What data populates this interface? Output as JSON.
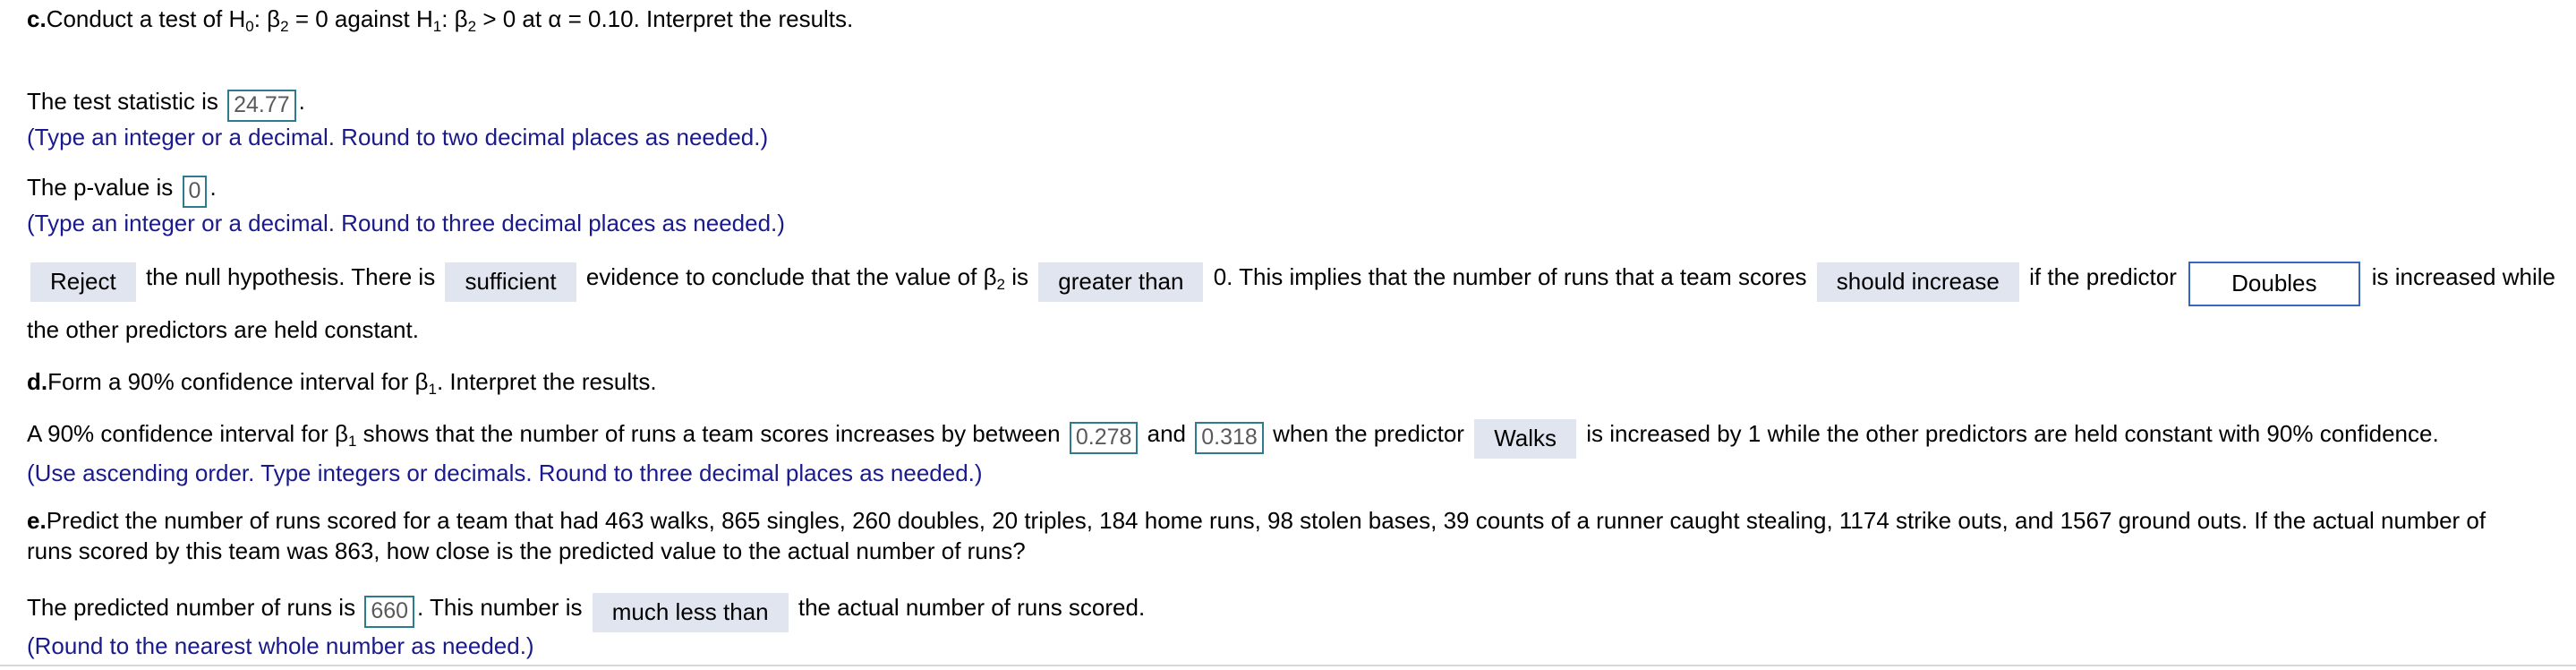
{
  "part_c": {
    "label": "c.",
    "prompt_a": "Conduct a test of H",
    "prompt_sub_0": "0",
    "prompt_b": ": β",
    "prompt_sub_2a": "2",
    "prompt_c": " = 0 against H",
    "prompt_sub_1": "1",
    "prompt_d": ": β",
    "prompt_sub_2b": "2",
    "prompt_e": " > 0 at α = 0.10. Interpret the results.",
    "test_statistic_label": "The test statistic is",
    "test_statistic_value": "24.77",
    "test_statistic_period": ".",
    "test_statistic_hint": "(Type an integer or a decimal. Round to two decimal places as needed.)",
    "pvalue_label": "The p-value is",
    "pvalue_value": "0",
    "pvalue_period": ".",
    "pvalue_hint": "(Type an integer or a decimal. Round to three decimal places as needed.)",
    "conclusion": {
      "dropdown_reject": "Reject",
      "text_1": "the null hypothesis. There is",
      "dropdown_sufficiency": "sufficient",
      "text_2": "evidence to conclude that the value of β",
      "text_2_sub": "2",
      "text_3": "is",
      "dropdown_direction": "greater than",
      "text_4": "0. This implies that the number of runs that a team scores",
      "dropdown_effect": "should increase",
      "text_5": "if the predictor",
      "dropdown_predictor": "Doubles",
      "text_6": "is increased while",
      "text_7": "the other predictors are held constant."
    }
  },
  "part_d": {
    "label": "d.",
    "prompt_a": "Form a 90% confidence interval for β",
    "prompt_sub_1": "1",
    "prompt_b": ". Interpret the results.",
    "answer": {
      "text_1": "A 90% confidence interval for β",
      "text_1_sub": "1",
      "text_2": "shows that the number of runs a team scores increases by between",
      "ci_lower": "0.278",
      "text_and": "and",
      "ci_upper": "0.318",
      "text_3": "when the predictor",
      "dropdown_predictor": "Walks",
      "text_4": "is increased by 1 while the other predictors are held constant with 90% confidence."
    },
    "hint": "(Use ascending order. Type integers or decimals. Round to three decimal places as needed.)"
  },
  "part_e": {
    "label": "e.",
    "prompt_line1": "Predict the number of runs scored for a team that had 463 walks, 865 singles, 260 doubles, 20 triples, 184 home runs, 98 stolen bases, 39 counts of a runner caught stealing, 1174 strike outs, and 1567 ground outs. If the actual number of",
    "prompt_line2": "runs scored by this team was 863, how close is the predicted value to the actual number of runs?",
    "answer": {
      "text_1": "The predicted number of runs is",
      "predicted_value": "660",
      "text_2": ". This number is",
      "dropdown_comparison": "much less than",
      "text_3": "the actual number of runs scored."
    },
    "hint": "(Round to the nearest whole number as needed.)"
  },
  "colors": {
    "hint_blue": "#1a1a8c",
    "input_border_teal": "#2e7b8c",
    "input_text_grey": "#5a5a5a",
    "dropdown_fill": "#e1e5f0",
    "focus_border_blue": "#3b63c4",
    "divider_grey": "#d8d8d8",
    "background": "#ffffff"
  }
}
